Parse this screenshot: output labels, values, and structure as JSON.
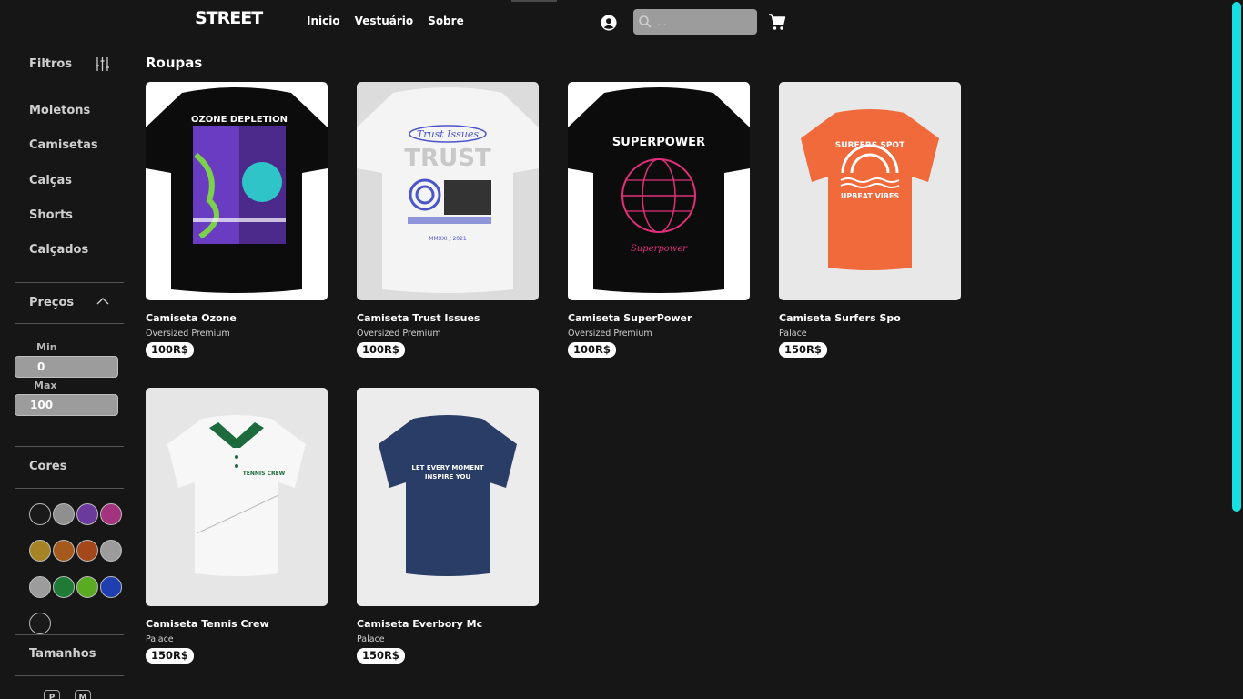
{
  "header": {
    "logo": "STREET",
    "nav": [
      {
        "label": "Inicio"
      },
      {
        "label": "Vestuário"
      },
      {
        "label": "Sobre"
      }
    ],
    "search_placeholder": "..."
  },
  "sidebar": {
    "filters_label": "Filtros",
    "categories": [
      "Moletons",
      "Camisetas",
      "Calças",
      "Shorts",
      "Calçados"
    ],
    "prices_label": "Preços",
    "min_label": "Min",
    "min_value": "0",
    "max_label": "Max",
    "max_value": "100",
    "colors_label": "Cores",
    "colors": [
      "#1a1a1a",
      "#8f8f8f",
      "#6a3a9c",
      "#a3337f",
      "#a68325",
      "#a55a1c",
      "#a4471a",
      "#9c9c9c",
      "#9c9c9c",
      "#1f7a35",
      "#5aaa22",
      "#1f3fb0",
      "#1a1a1a"
    ],
    "sizes_label": "Tamanhos",
    "sizes": [
      "P",
      "M"
    ]
  },
  "main": {
    "title": "Roupas",
    "products": [
      {
        "name": "Camiseta Ozone",
        "brand": "Oversized Premium",
        "price": "100R$",
        "shirt": "black",
        "graphic": "ozone"
      },
      {
        "name": "Camiseta Trust Issues",
        "brand": "Oversized Premium",
        "price": "100R$",
        "shirt": "white",
        "graphic": "trust"
      },
      {
        "name": "Camiseta SuperPower",
        "brand": "Oversized Premium",
        "price": "100R$",
        "shirt": "black",
        "graphic": "globe"
      },
      {
        "name": "Camiseta Surfers Spo",
        "brand": "Palace",
        "price": "150R$",
        "shirt": "orange",
        "graphic": "surf"
      },
      {
        "name": "Camiseta Tennis Crew",
        "brand": "Palace",
        "price": "150R$",
        "shirt": "white-polo",
        "graphic": "tennis"
      },
      {
        "name": "Camiseta Everbory Mc",
        "brand": "Palace",
        "price": "150R$",
        "shirt": "navy",
        "graphic": "moment"
      }
    ]
  },
  "accent_color": "#16e0e0"
}
